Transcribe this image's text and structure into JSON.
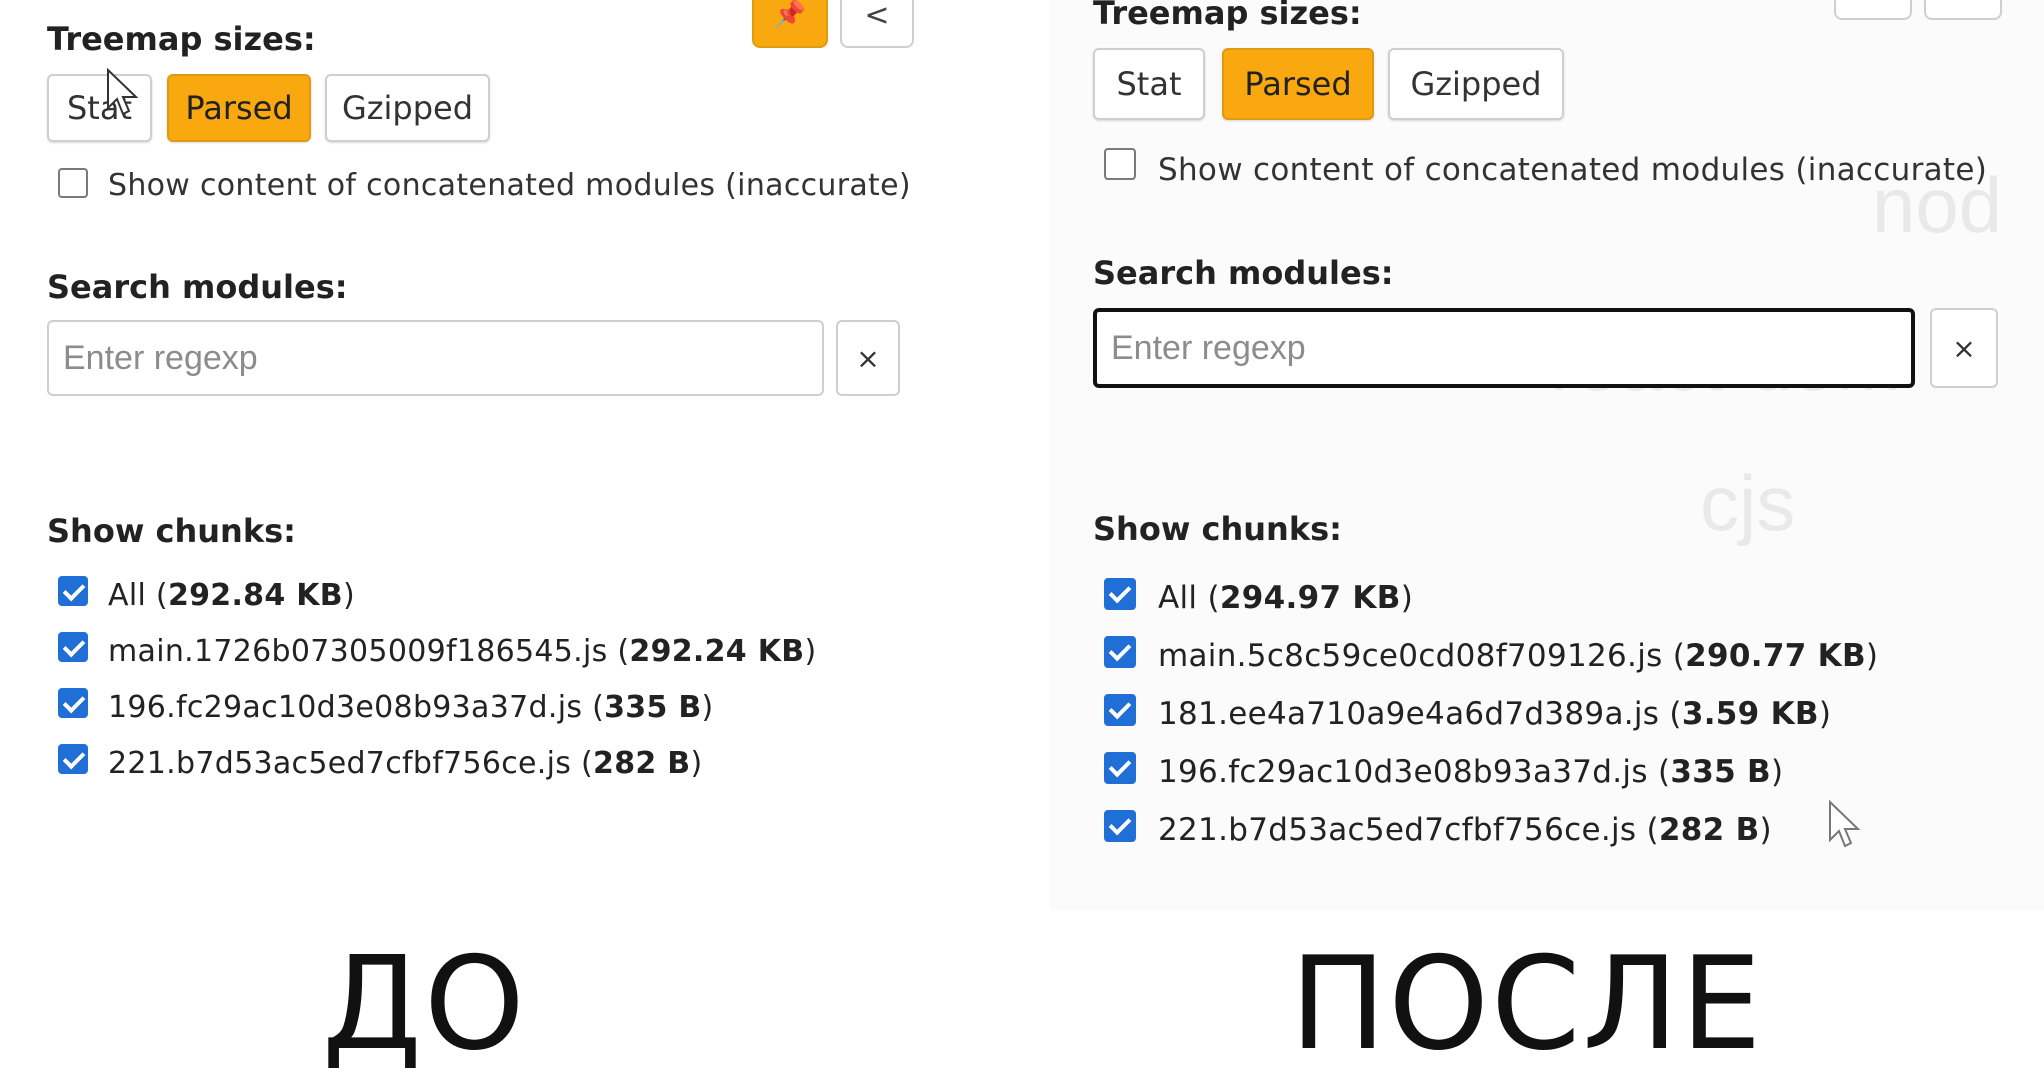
{
  "left": {
    "treemap_title": "Treemap sizes:",
    "buttons": [
      "Stat",
      "Parsed",
      "Gzipped"
    ],
    "active_button": "Parsed",
    "concat_label": "Show content of concatenated modules (inaccurate)",
    "search_title": "Search modules:",
    "search_placeholder": "Enter regexp",
    "clear_label": "×",
    "chunks_title": "Show chunks:",
    "chunks": [
      {
        "name": "All",
        "size": "292.84 KB"
      },
      {
        "name": "main.1726b07305009f186545.js",
        "size": "292.24 KB"
      },
      {
        "name": "196.fc29ac10d3e08b93a37d.js",
        "size": "335 B"
      },
      {
        "name": "221.b7d53ac5ed7cfbf756ce.js",
        "size": "282 B"
      }
    ],
    "top_buttons": [
      "📌",
      "<"
    ],
    "caption": "ДО"
  },
  "right": {
    "treemap_title": "Treemap sizes:",
    "buttons": [
      "Stat",
      "Parsed",
      "Gzipped"
    ],
    "active_button": "Parsed",
    "concat_label": "Show content of concatenated modules (inaccurate)",
    "search_title": "Search modules:",
    "search_placeholder": "Enter regexp",
    "clear_label": "×",
    "chunks_title": "Show chunks:",
    "chunks": [
      {
        "name": "All",
        "size": "294.97 KB"
      },
      {
        "name": "main.5c8c59ce0cd08f709126.js",
        "size": "290.77 KB"
      },
      {
        "name": "181.ee4a710a9e4a6d7d389a.js",
        "size": "3.59 KB"
      },
      {
        "name": "196.fc29ac10d3e08b93a37d.js",
        "size": "335 B"
      },
      {
        "name": "221.b7d53ac5ed7cfbf756ce.js",
        "size": "282 B"
      }
    ],
    "background_text": [
      "nod",
      "react-dom",
      "cjs"
    ],
    "caption": "ПОСЛЕ"
  },
  "colors": {
    "active": "#f9a90f",
    "checkbox": "#1f6fd6"
  }
}
